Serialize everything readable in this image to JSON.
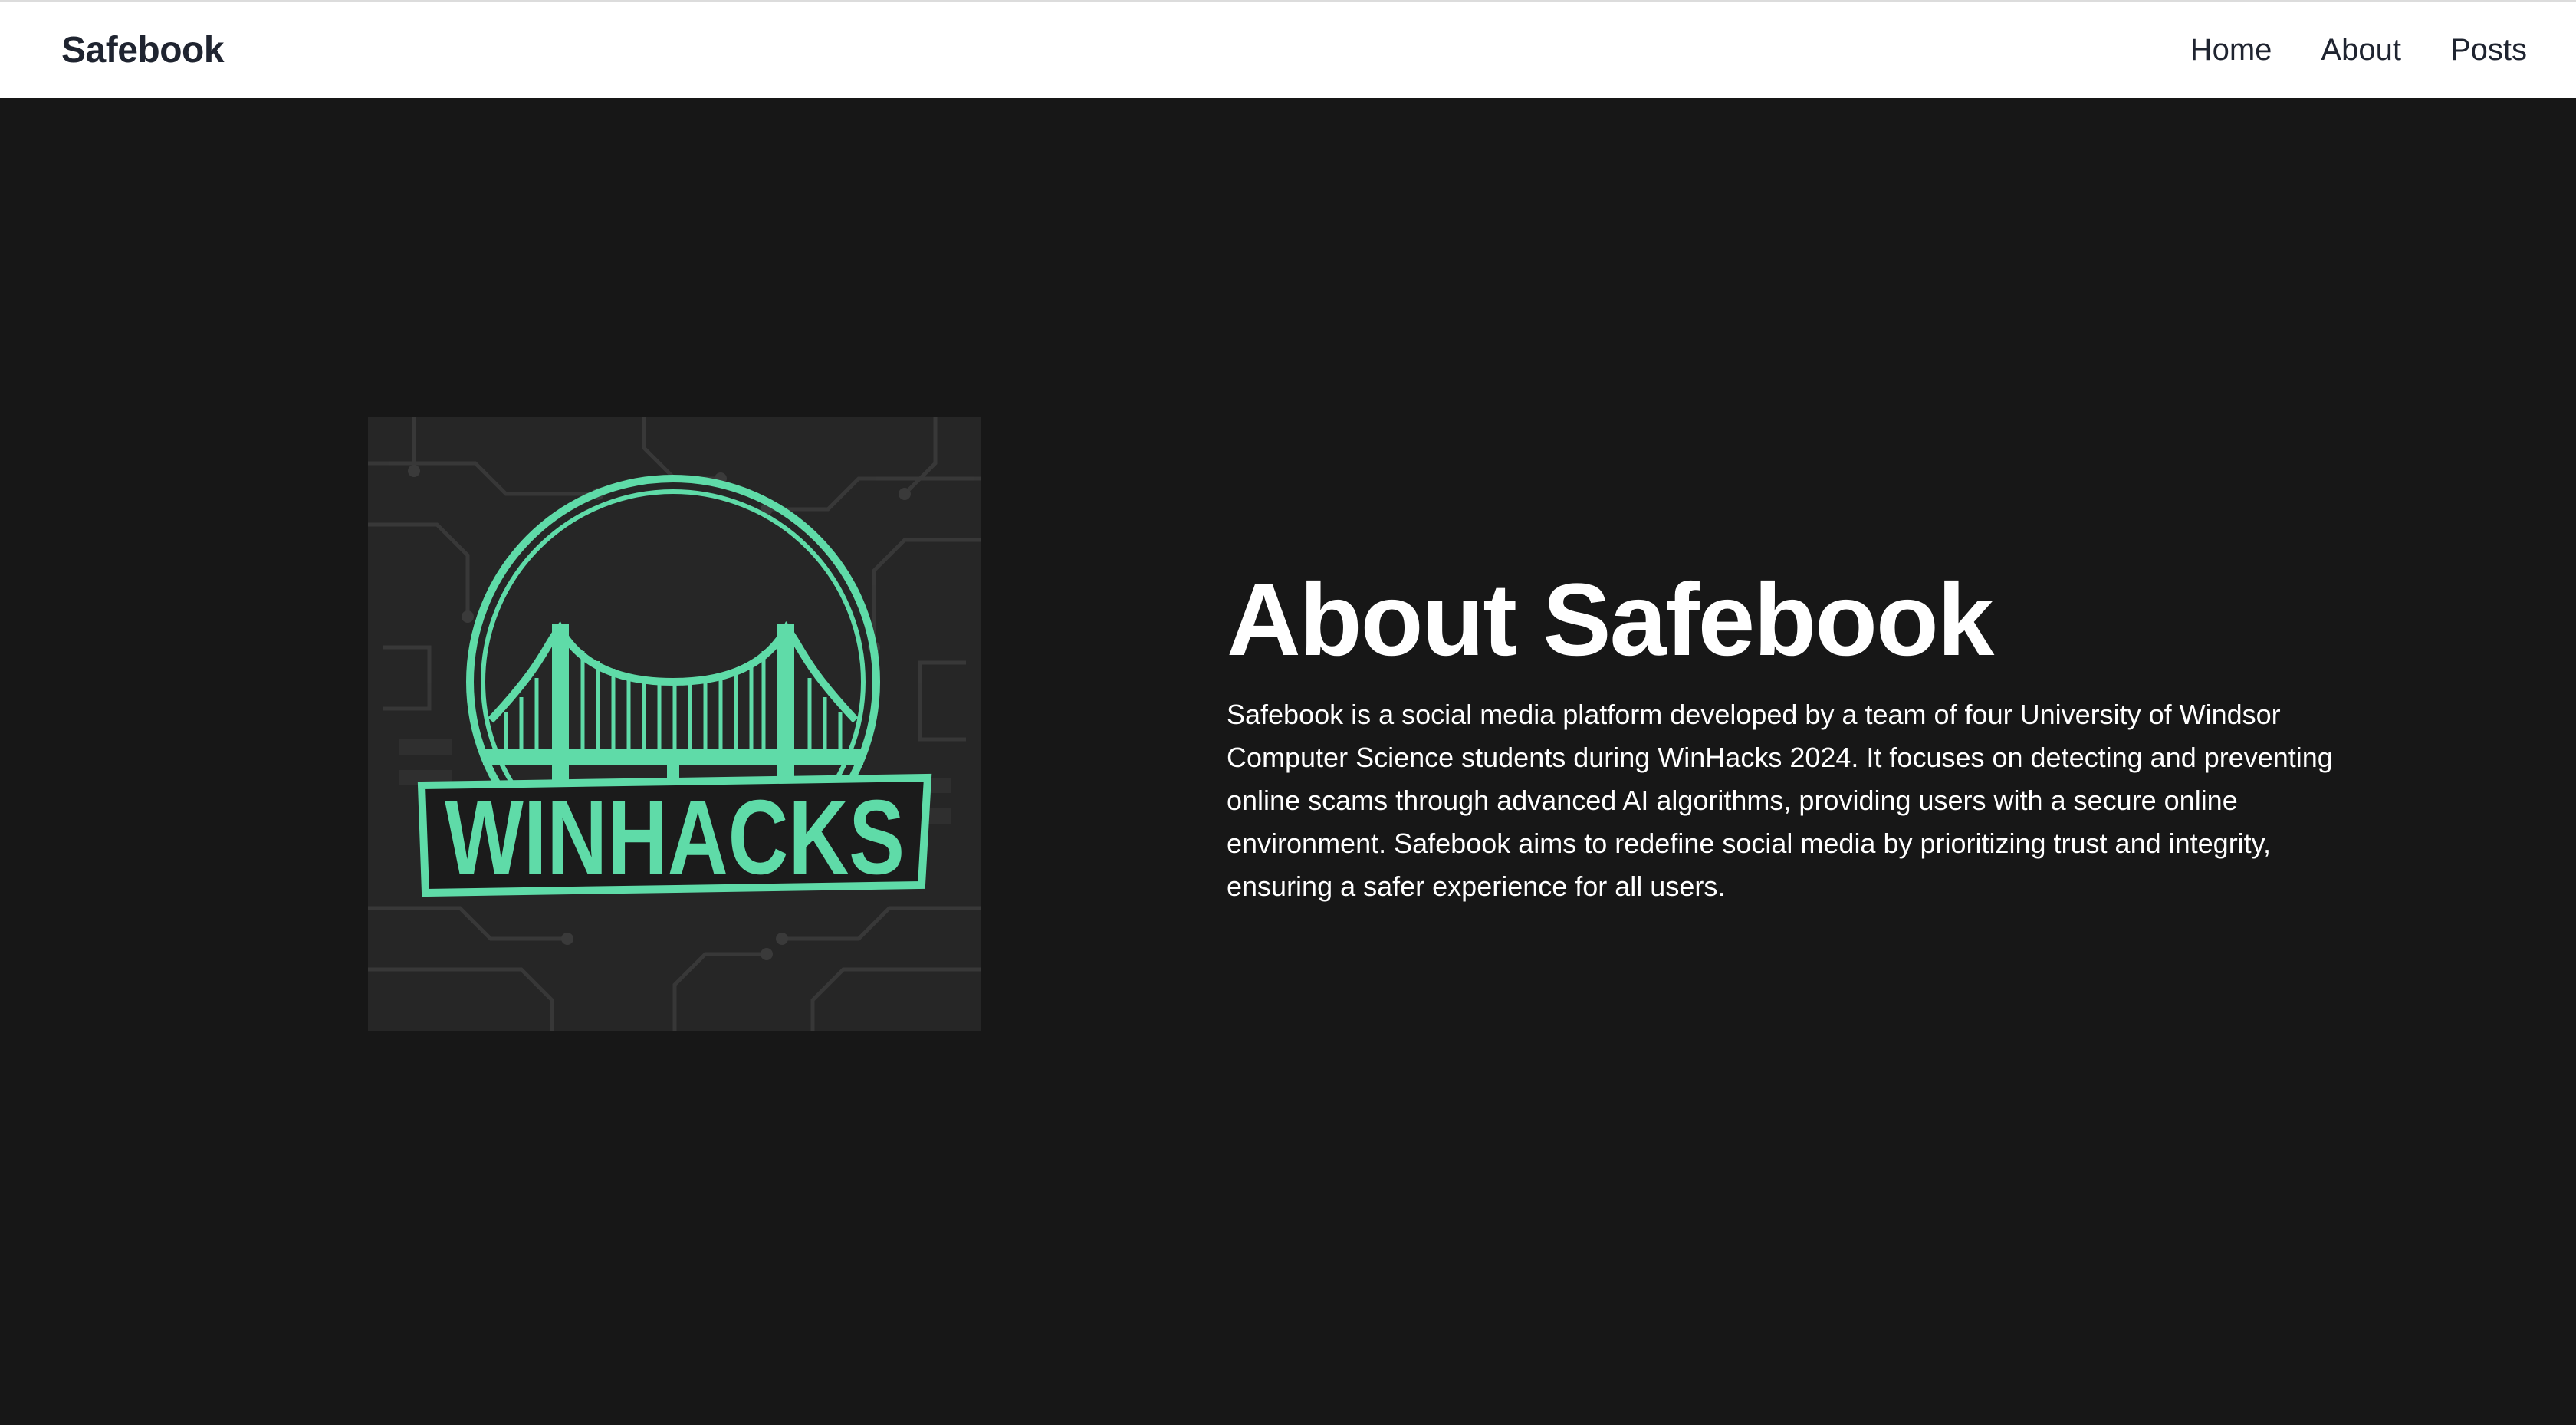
{
  "navbar": {
    "brand": "Safebook",
    "links": [
      {
        "label": "Home"
      },
      {
        "label": "About"
      },
      {
        "label": "Posts"
      }
    ]
  },
  "about": {
    "title": "About Safebook",
    "description": "Safebook is a social media platform developed by a team of four University of Windsor Computer Science students during WinHacks 2024. It focuses on detecting and preventing online scams through advanced AI algorithms, providing users with a secure online environment. Safebook aims to redefine social media by prioritizing trust and integrity, ensuring a safer experience for all users."
  },
  "logo": {
    "text": "WINHACKS",
    "accent_color": "#5fdba8",
    "background_color": "#262626"
  },
  "colors": {
    "page_background": "#171717",
    "navbar_background": "#ffffff",
    "nav_text": "#1f2430",
    "body_text": "#ffffff"
  }
}
